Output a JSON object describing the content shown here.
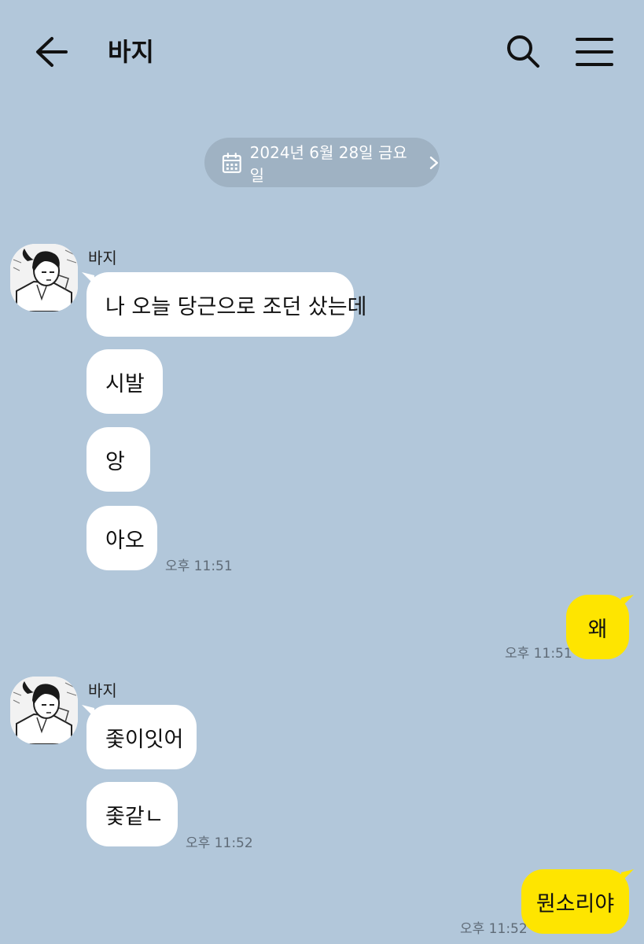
{
  "header": {
    "title": "바지",
    "back_icon": "back-arrow-icon",
    "search_icon": "search-icon",
    "menu_icon": "hamburger-menu-icon"
  },
  "date_divider": {
    "label": "2024년 6월 28일 금요일",
    "icon": "calendar-icon"
  },
  "colors": {
    "background": "#b2c7da",
    "incoming_bubble": "#ffffff",
    "outgoing_bubble": "#fee500"
  },
  "messages": {
    "g1_sender": "바지",
    "g1_m1": "나 오늘 당근으로 조던 샀는데",
    "g1_m2": "시발",
    "g1_m3": "앙",
    "g1_m4": "아오",
    "g1_time": "오후 11:51",
    "o1_text": "왜",
    "o1_time": "오후 11:51",
    "g2_sender": "바지",
    "g2_m1": "좇이잇어",
    "g2_m2": "좇같ㄴ",
    "g2_time": "오후 11:52",
    "o2_text": "뭔소리야",
    "o2_time": "오후 11:52"
  }
}
